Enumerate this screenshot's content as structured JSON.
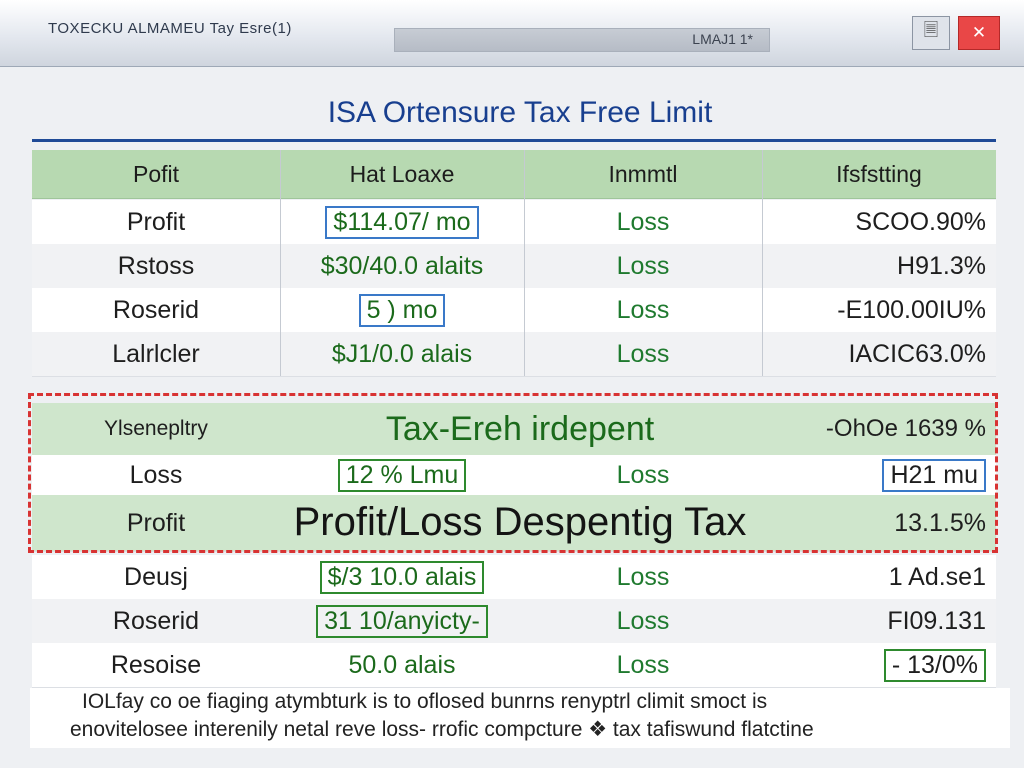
{
  "window": {
    "title": "TOXECKU  ALMAMEU Tay Esre(1)",
    "search_text": "LMAJ1 1*",
    "doc_icon": "document-icon",
    "close_icon": "close-icon"
  },
  "page": {
    "title": "ISA Ortensure Tax Free Limit"
  },
  "table": {
    "headers": [
      "Pofit",
      "Hat  Loaxe",
      "Inmmtl",
      "Ifsfstting"
    ],
    "rows": [
      [
        "Profit",
        "$114.07/ mo",
        "Loss",
        "SCOO.90%"
      ],
      [
        "Rstoss",
        "$30/40.0 alaits",
        "Loss",
        "H91.3%"
      ],
      [
        "Roserid",
        "5 ) mo",
        "Loss",
        "-E100.00IU%"
      ],
      [
        "Lalrlcler",
        "$J1/0.0 alais",
        "Loss",
        "IACIC63.0%"
      ]
    ]
  },
  "group": {
    "label": "Ylsenepltry",
    "name": "Tax-Ereh irdepent",
    "percent": "-OhOe 1639 %",
    "rows": [
      [
        "Loss",
        "12 % Lmu",
        "Loss",
        "H21 mu"
      ],
      [
        "Profit",
        "",
        "",
        "13.1.5%"
      ]
    ],
    "caption": "Profit/Loss Despentig Tax"
  },
  "table_after": {
    "rows": [
      [
        "Deusj",
        "$/3 10.0 alais",
        "Loss",
        "1 Ad.se1"
      ],
      [
        "Roserid",
        "31 10/anyicty-",
        "Loss",
        "FI09.131"
      ],
      [
        "Resoise",
        "50.0 alais",
        "Loss",
        "- 13/0%"
      ]
    ]
  },
  "footnote": {
    "line1": "IOLfay co oe fiaging atymbturk is to oflosed bunrns renyptrl climit smoct is",
    "line2": "enovitelosee interenily netal reve loss- rrofic compcture ❖ tax tafiswund flatctine"
  }
}
